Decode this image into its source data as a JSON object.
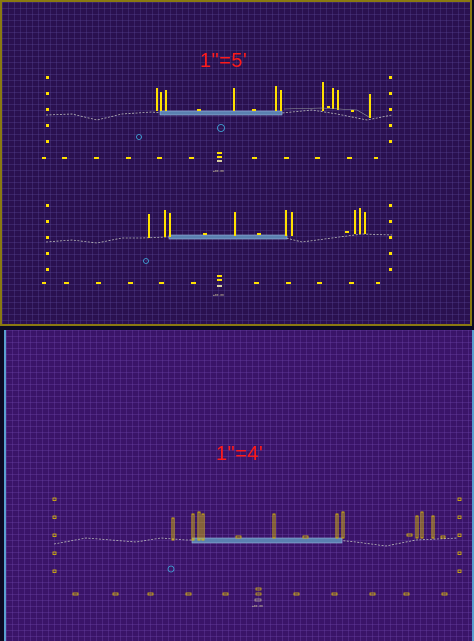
{
  "top_panel": {
    "scale_label": "1\"=5'",
    "section_labels": [
      "±00.00",
      "±00.00"
    ]
  },
  "bottom_panel": {
    "scale_label": "1\"=4'",
    "section_label": "±00.00"
  },
  "colors": {
    "top_background": "#2a1150",
    "bottom_background": "#3a1468",
    "scale_text": "#ff1a1a",
    "marks": "#ffe000",
    "marks_outline": "#e0c000",
    "ground_line": "#b8b8b8",
    "channel": "#5a80b0",
    "circle": "#40b0e0"
  }
}
